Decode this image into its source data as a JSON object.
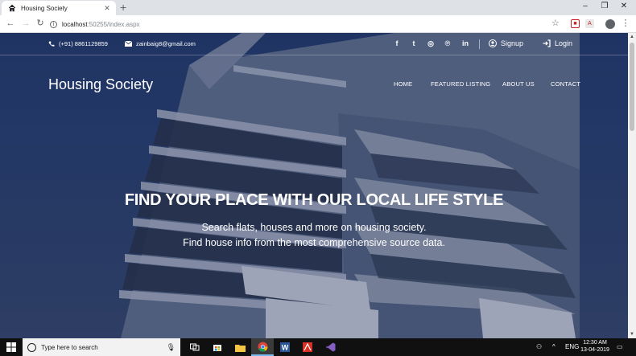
{
  "browser": {
    "tab_title": "Housing Society",
    "new_tab_symbol": "+",
    "close_symbol": "✕",
    "url_host": "localhost",
    "url_rest": ":50255/index.aspx",
    "window_controls": [
      "–",
      "❐",
      "✕"
    ],
    "back": "←",
    "forward": "→",
    "reload": "↻",
    "star": "☆",
    "menu": "⋮"
  },
  "site": {
    "topbar": {
      "phone": "(+91) 8861129859",
      "email": "zainbaig8@gmail.com",
      "social": [
        {
          "name": "facebook-icon",
          "glyph": "f"
        },
        {
          "name": "twitter-icon",
          "glyph": "t"
        },
        {
          "name": "instagram-icon",
          "glyph": "◎"
        },
        {
          "name": "pinterest-icon",
          "glyph": "℗"
        },
        {
          "name": "linkedin-icon",
          "glyph": "in"
        }
      ],
      "signup": "Signup",
      "login": "Login"
    },
    "brand": "Housing Society",
    "menu": [
      "HOME",
      "FEATURED LISTING",
      "ABOUT US",
      "CONTACT"
    ],
    "hero": {
      "title": "FIND YOUR PLACE WITH OUR LOCAL LIFE STYLE",
      "line1": "Search flats, houses and more on housing society.",
      "line2": "Find house info from the most comprehensive source data."
    }
  },
  "taskbar": {
    "search_placeholder": "Type here to search",
    "language": "ENG",
    "time": "12:30 AM",
    "date": "13-04-2019"
  },
  "colors": {
    "hero_overlay": "#1d2f55",
    "taskbar": "#101010",
    "browser_tabbar": "#dee1e6"
  }
}
